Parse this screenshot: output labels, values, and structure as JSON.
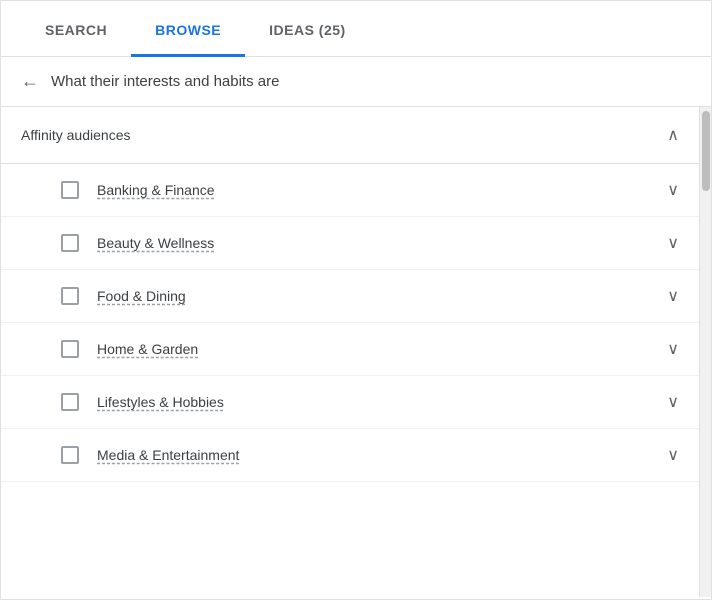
{
  "tabs": [
    {
      "id": "search",
      "label": "SEARCH",
      "active": false
    },
    {
      "id": "browse",
      "label": "BROWSE",
      "active": true
    },
    {
      "id": "ideas",
      "label": "IDEAS (25)",
      "active": false
    }
  ],
  "breadcrumb": {
    "back_label": "←",
    "text": "What their interests and habits are"
  },
  "section": {
    "title": "Affinity audiences",
    "collapse_icon": "∧"
  },
  "items": [
    {
      "id": "banking",
      "label": "Banking & Finance"
    },
    {
      "id": "beauty",
      "label": "Beauty & Wellness"
    },
    {
      "id": "food",
      "label": "Food & Dining"
    },
    {
      "id": "home",
      "label": "Home & Garden"
    },
    {
      "id": "lifestyles",
      "label": "Lifestyles & Hobbies"
    },
    {
      "id": "media",
      "label": "Media & Entertainment"
    }
  ],
  "chevron_down": "∨",
  "chevron_up": "∧"
}
